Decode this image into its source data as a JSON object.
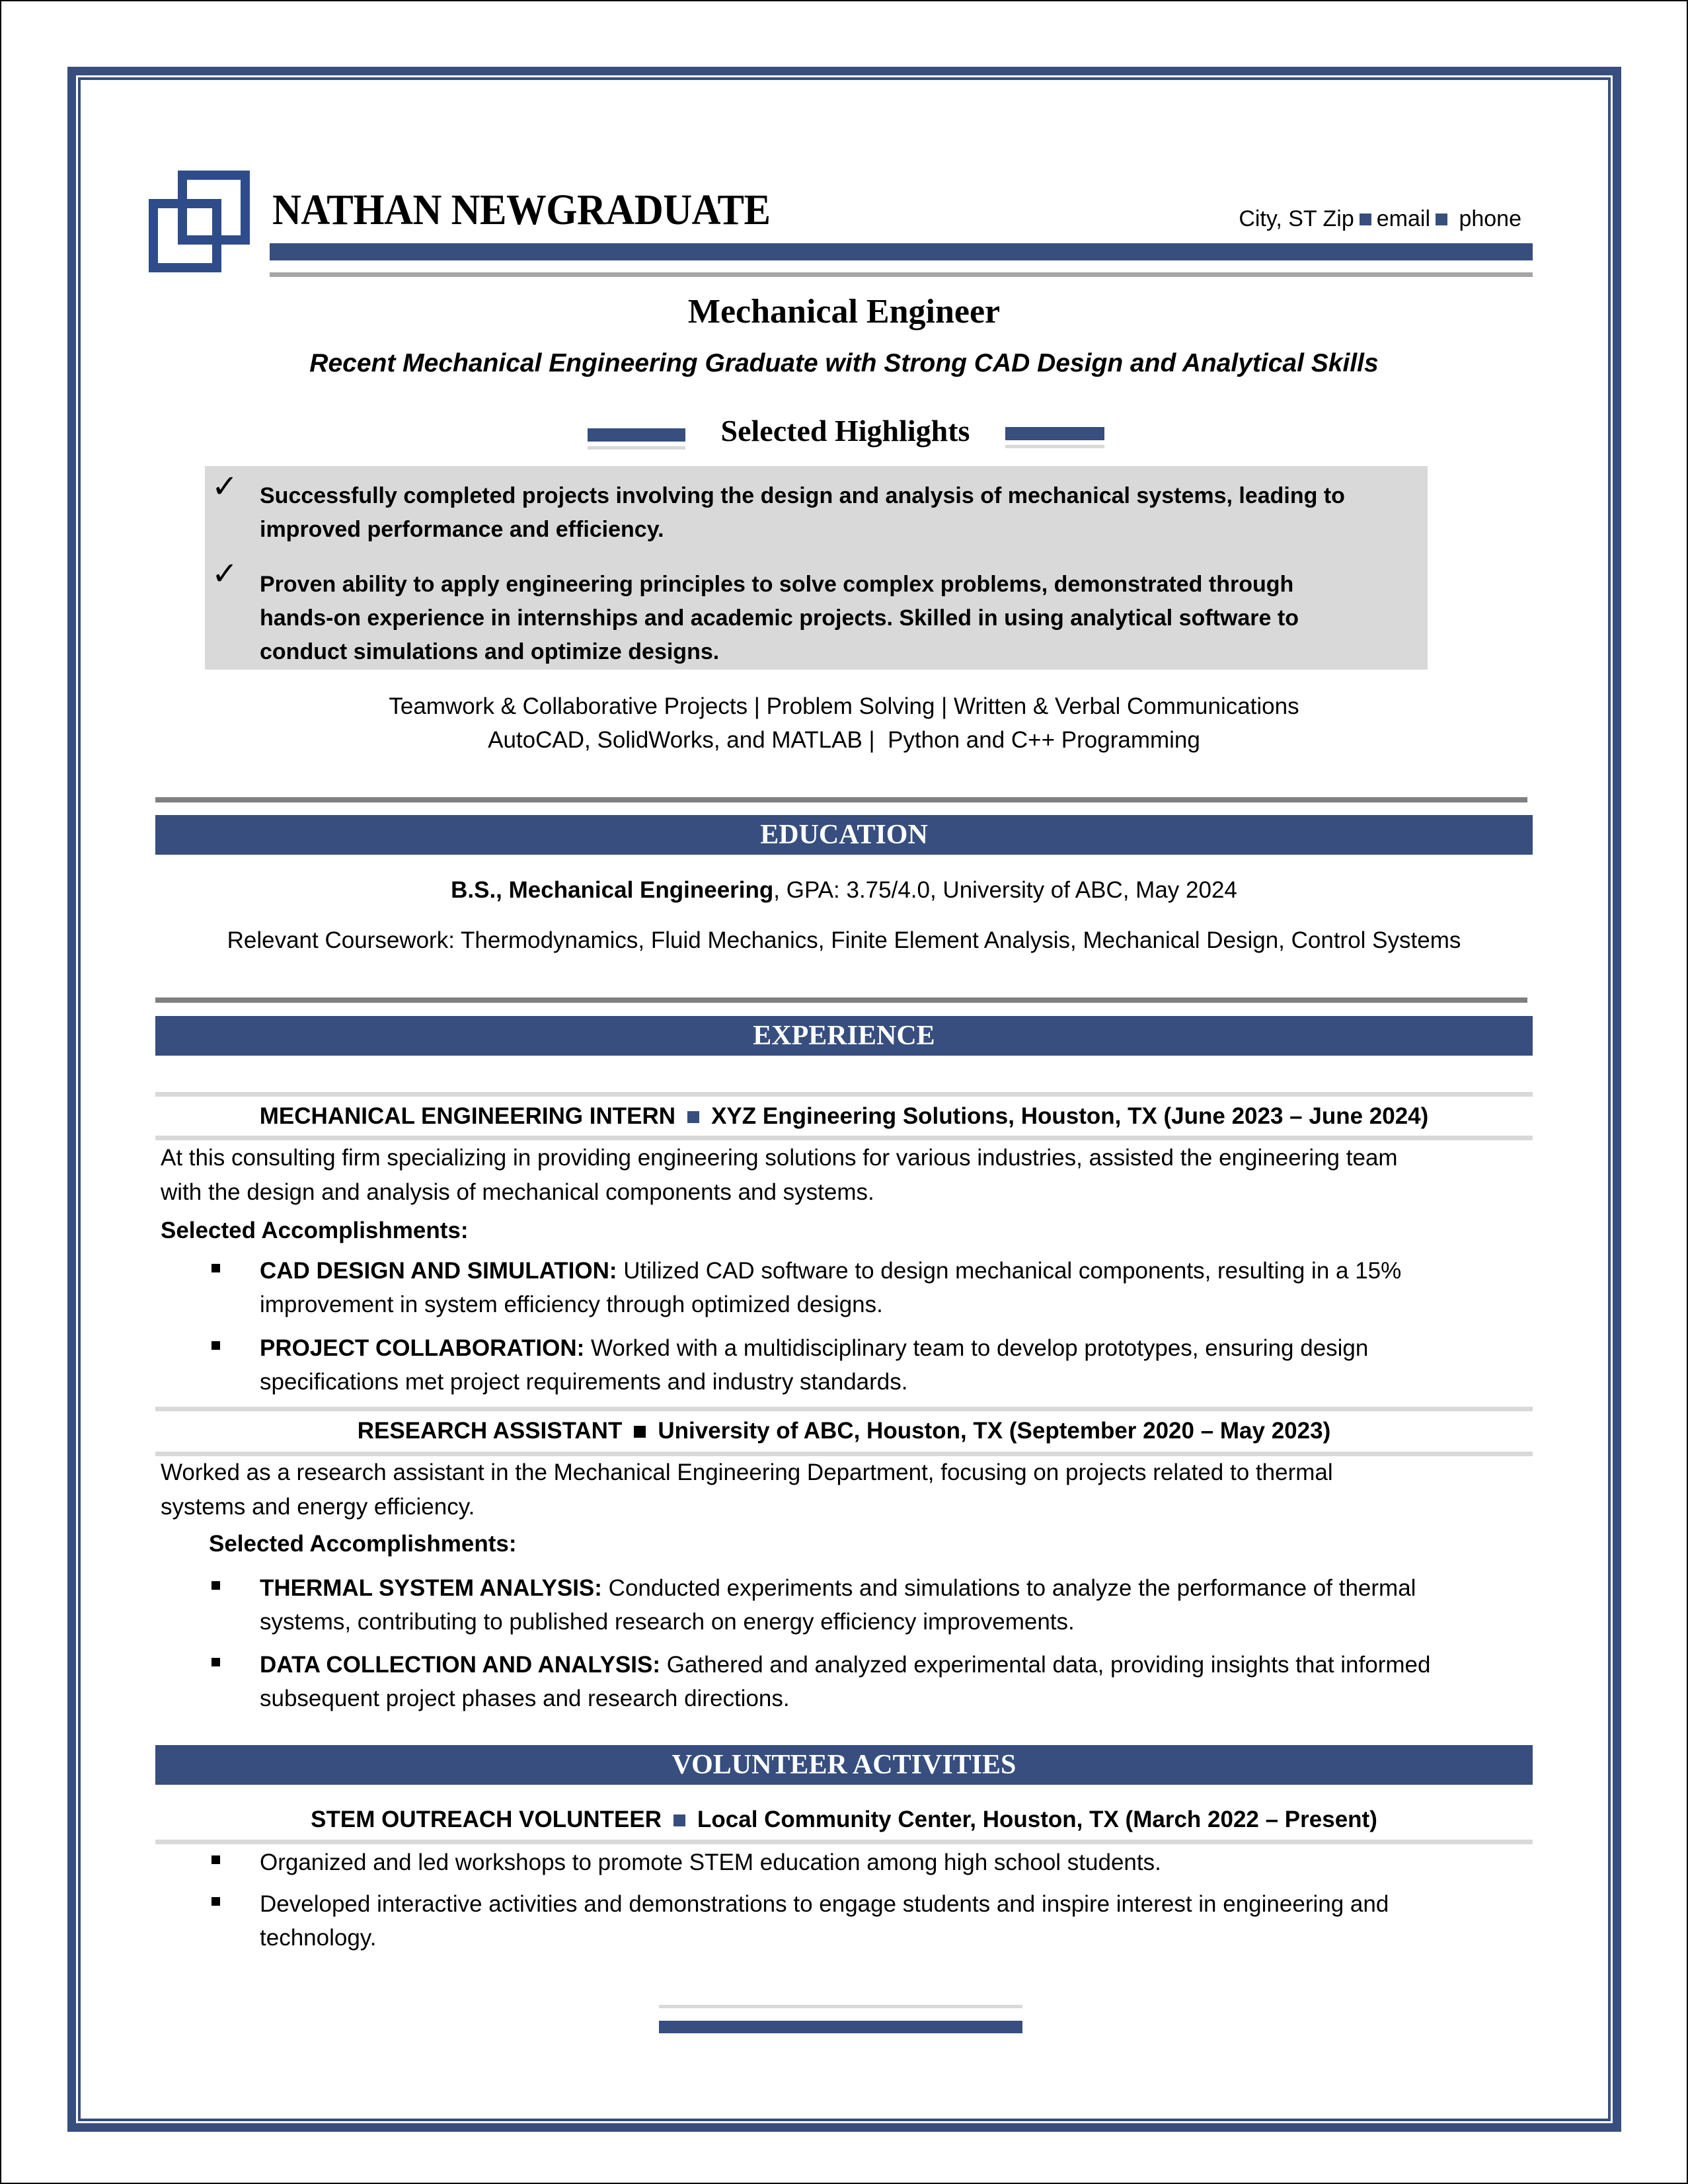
{
  "header": {
    "name": "NATHAN NEWGRADUATE",
    "contact": {
      "city": "City, ST Zip",
      "email": "email",
      "phone": "phone"
    },
    "logo_icon": "overlapping-squares-logo"
  },
  "title": "Mechanical Engineer",
  "subtitle": "Recent Mechanical Engineering Graduate with Strong CAD Design and Analytical Skills",
  "highlights": {
    "heading": "Selected Highlights",
    "items": [
      {
        "icon": "check-icon",
        "lines": [
          "Successfully completed projects involving the design and analysis of mechanical systems, leading to",
          "improved performance and efficiency."
        ]
      },
      {
        "icon": "check-icon",
        "lines": [
          "Proven ability to apply engineering principles to solve complex problems, demonstrated through",
          "hands-on experience in internships and academic projects. Skilled in using analytical software to",
          "conduct simulations and optimize designs."
        ]
      }
    ],
    "skills": [
      "Teamwork & Collaborative Projects | Problem Solving | Written & Verbal Communications",
      "AutoCAD, SolidWorks, and MATLAB |  Python and C++ Programming"
    ]
  },
  "education": {
    "heading": "EDUCATION",
    "degree_bold": "B.S., Mechanical Engineering",
    "degree_rest": ", GPA: 3.75/4.0, University of ABC, May 2024",
    "coursework": "Relevant Coursework: Thermodynamics, Fluid Mechanics, Finite Element Analysis, Mechanical Design, Control Systems"
  },
  "experience": {
    "heading": "EXPERIENCE",
    "jobs": [
      {
        "title": "MECHANICAL ENGINEERING INTERN",
        "details": "XYZ Engineering Solutions, Houston, TX (June 2023 – June 2024)",
        "separator_color": "#374e7f",
        "description": [
          "At this consulting firm specializing in providing engineering solutions for various industries, assisted the engineering team",
          "with the design and analysis of mechanical components and systems."
        ],
        "accomplishments_label": "Selected Accomplishments:",
        "bullets": [
          {
            "label": "CAD DESIGN AND SIMULATION:",
            "lines": [
              " Utilized CAD software to design mechanical components, resulting in a 15%",
              "improvement in system efficiency through optimized designs."
            ]
          },
          {
            "label": "PROJECT COLLABORATION:",
            "lines": [
              " Worked with a multidisciplinary team to develop prototypes, ensuring design",
              "specifications met project requirements and industry standards."
            ]
          }
        ]
      },
      {
        "title": "RESEARCH ASSISTANT",
        "details": "University of ABC, Houston, TX (September 2020 – May 2023)",
        "separator_color": "#000000",
        "description": [
          "Worked as a research assistant in the Mechanical Engineering Department, focusing on projects related to thermal",
          "systems and energy efficiency."
        ],
        "accomplishments_label": "Selected Accomplishments:",
        "bullets": [
          {
            "label": "THERMAL SYSTEM ANALYSIS:",
            "lines": [
              " Conducted experiments and simulations to analyze the performance of thermal",
              "systems, contributing to published research on energy efficiency improvements."
            ]
          },
          {
            "label": "DATA COLLECTION AND ANALYSIS:",
            "lines": [
              " Gathered and analyzed experimental data, providing insights that informed",
              "subsequent project phases and research directions."
            ]
          }
        ]
      }
    ]
  },
  "volunteer": {
    "heading": "VOLUNTEER ACTIVITIES",
    "title": "STEM OUTREACH VOLUNTEER",
    "details": "Local Community Center, Houston, TX (March 2022 – Present)",
    "bullets": [
      [
        "Organized and led workshops to promote STEM education among high school students."
      ],
      [
        "Developed interactive activities and demonstrations to engage students and inspire interest in engineering and",
        "technology."
      ]
    ]
  },
  "colors": {
    "accent": "#374e7f",
    "highlight_bg": "#d9d9d9",
    "rule_gray": "#808080",
    "rule_light": "#d9d9d9"
  }
}
